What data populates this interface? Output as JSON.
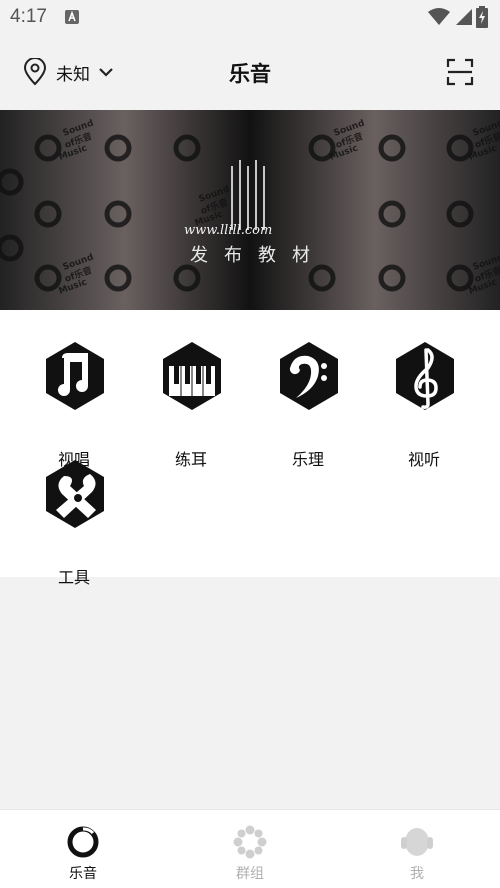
{
  "status_bar": {
    "time": "4:17"
  },
  "header": {
    "location": "未知",
    "title": "乐音"
  },
  "banner": {
    "logo_text": "www.llill.com",
    "caption": "发布教材",
    "pattern_text_1": "Sound",
    "pattern_text_2": "of乐音",
    "pattern_text_3": "Music"
  },
  "grid": {
    "items": [
      {
        "label": "视唱",
        "icon": "music-note-icon"
      },
      {
        "label": "练耳",
        "icon": "piano-keys-icon"
      },
      {
        "label": "乐理",
        "icon": "bass-clef-icon"
      },
      {
        "label": "视听",
        "icon": "treble-clef-icon"
      },
      {
        "label": "工具",
        "icon": "tools-icon"
      }
    ]
  },
  "tabbar": {
    "tabs": [
      {
        "label": "乐音",
        "active": true
      },
      {
        "label": "群组",
        "active": false
      },
      {
        "label": "我",
        "active": false
      }
    ]
  },
  "colors": {
    "accent": "#111111",
    "inactive": "#b0b0b0",
    "background": "#f2f2f2"
  }
}
